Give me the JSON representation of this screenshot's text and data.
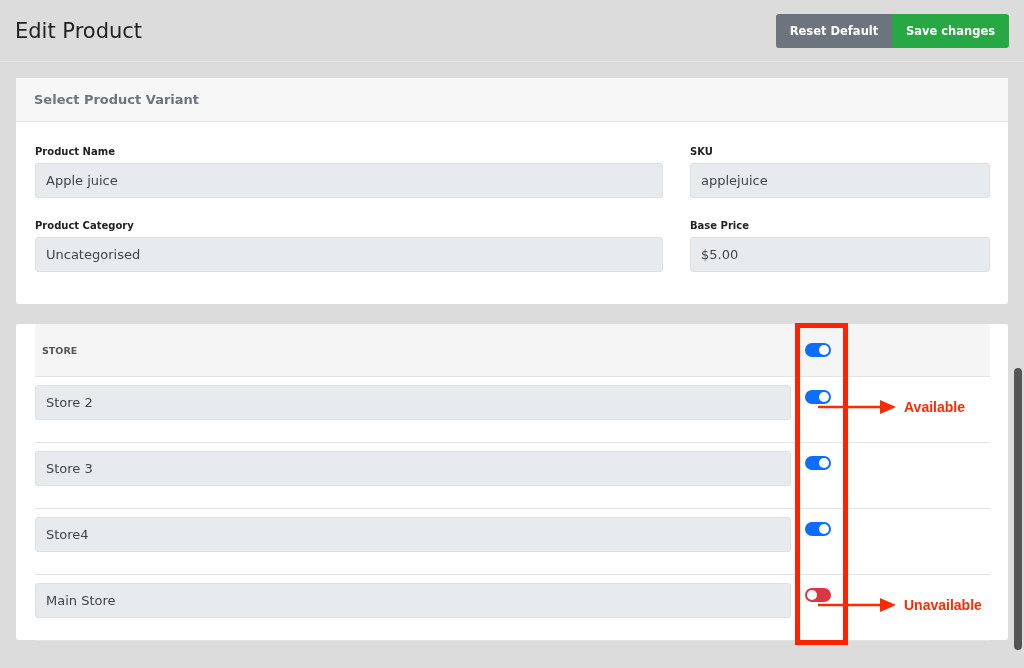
{
  "page_title": "Edit Product",
  "actions": [
    {
      "label": "Reset Default",
      "kind": "secondary"
    },
    {
      "label": "Save changes",
      "kind": "primary"
    }
  ],
  "variant_card": {
    "title": "Select Product Variant",
    "fields": [
      {
        "label": "Product Name",
        "value": "Apple juice"
      },
      {
        "label": "SKU",
        "value": "applejuice"
      },
      {
        "label": "Product Category",
        "value": "Uncategorised"
      },
      {
        "label": "Base Price",
        "value": "$5.00"
      }
    ]
  },
  "store_table": {
    "header": {
      "label": "STORE",
      "on": true
    },
    "stores": [
      {
        "name": "Store 2",
        "on": true,
        "annotation": "Available"
      },
      {
        "name": "Store 3",
        "on": true
      },
      {
        "name": "Store4",
        "on": true
      },
      {
        "name": "Main Store",
        "on": false,
        "annotation": "Unavailable"
      }
    ]
  }
}
